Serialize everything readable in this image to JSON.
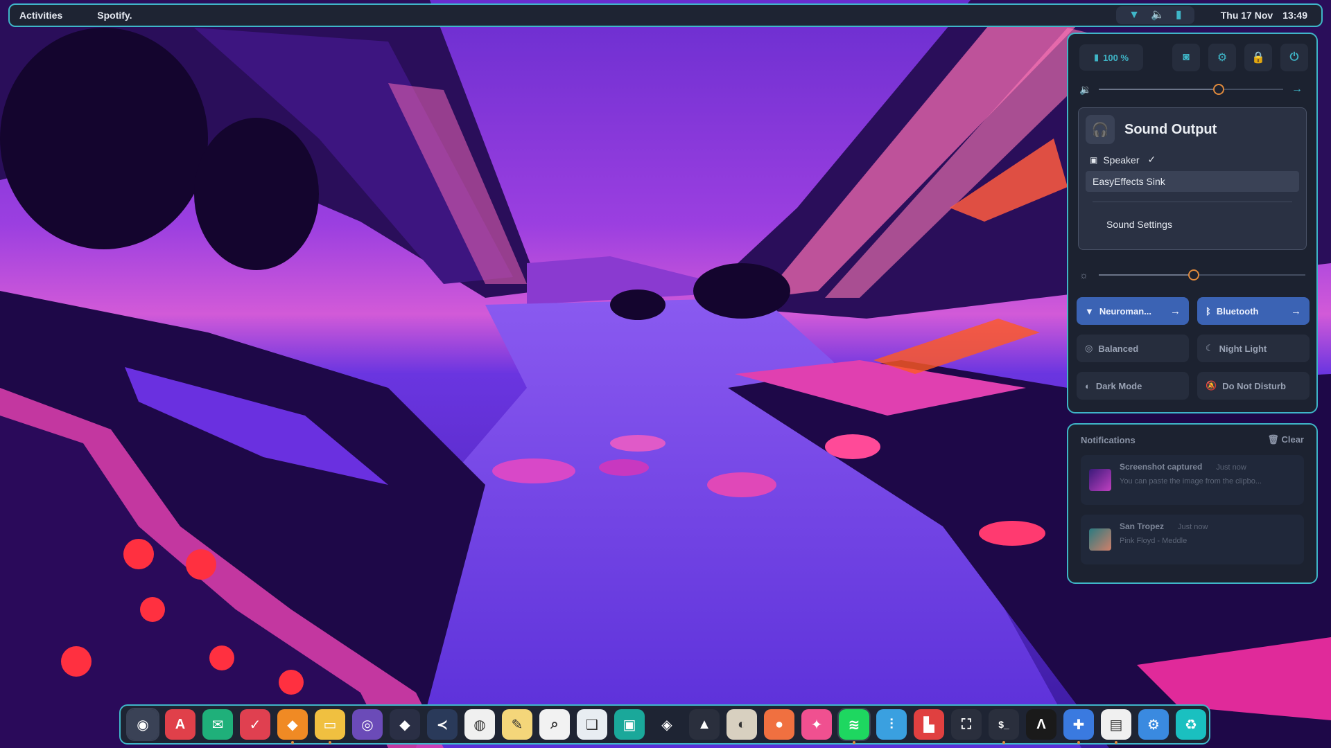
{
  "topbar": {
    "activities": "Activities",
    "app_name": "Spotify.",
    "tray_icons": [
      "wifi-icon",
      "volume-icon",
      "battery-icon"
    ],
    "date": "Thu 17 Nov",
    "time": "13:49"
  },
  "quick_settings": {
    "battery": "100 %",
    "icons": [
      "screenshot-icon",
      "settings-icon",
      "lock-icon",
      "power-icon"
    ],
    "volume_level": 0.65,
    "brightness_level": 0.46,
    "sound_output": {
      "title": "Sound Output",
      "devices": [
        {
          "label": "Speaker",
          "selected": true
        },
        {
          "label": "EasyEffects Sink",
          "selected": false
        }
      ],
      "settings_label": "Sound Settings"
    },
    "toggles": [
      {
        "label": "Neuroman...",
        "icon": "wifi-icon",
        "active": true,
        "has_arrow": true
      },
      {
        "label": "Bluetooth",
        "icon": "bluetooth-icon",
        "active": true,
        "has_arrow": true
      },
      {
        "label": "Balanced",
        "icon": "power-profile-icon",
        "active": false,
        "has_arrow": false
      },
      {
        "label": "Night Light",
        "icon": "moon-icon",
        "active": false,
        "has_arrow": false
      },
      {
        "label": "Dark Mode",
        "icon": "contrast-icon",
        "active": false,
        "has_arrow": false
      },
      {
        "label": "Do Not Disturb",
        "icon": "bell-off-icon",
        "active": false,
        "has_arrow": false
      }
    ]
  },
  "notifications": {
    "title": "Notifications",
    "clear_label": "Clear",
    "items": [
      {
        "title": "Screenshot captured",
        "time": "Just now",
        "message": "You can paste the image from the clipbo..."
      },
      {
        "title": "San Tropez",
        "time": "Just now",
        "message": "Pink Floyd - Meddle"
      }
    ]
  },
  "dock": {
    "apps": [
      {
        "name": "eye-app-icon",
        "color": "#3a4256",
        "glyph": "◉",
        "running": false,
        "active": true
      },
      {
        "name": "app-store-icon",
        "color": "#e0404a",
        "glyph": "A",
        "running": false
      },
      {
        "name": "mail-icon",
        "color": "#1fb07a",
        "glyph": "✉",
        "running": false
      },
      {
        "name": "tasks-icon",
        "color": "#e04050",
        "glyph": "✓",
        "running": false
      },
      {
        "name": "brave-browser-icon",
        "color": "#f08a24",
        "glyph": "◆",
        "running": true
      },
      {
        "name": "files-icon",
        "color": "#f0c040",
        "glyph": "▭",
        "running": true
      },
      {
        "name": "github-icon",
        "color": "#6b4bb8",
        "glyph": "◎",
        "running": false
      },
      {
        "name": "obsidian-icon",
        "color": "#2a2f45",
        "glyph": "◆",
        "running": false
      },
      {
        "name": "vscode-icon",
        "color": "#2a3a5a",
        "glyph": "≺",
        "running": false
      },
      {
        "name": "chromium-icon",
        "color": "#f0f0f0",
        "glyph": "◍",
        "running": false
      },
      {
        "name": "text-editor-icon",
        "color": "#f4d67a",
        "glyph": "✎",
        "running": false
      },
      {
        "name": "search-icon",
        "color": "#f2f2f2",
        "glyph": "⌕",
        "running": false
      },
      {
        "name": "book-reader-icon",
        "color": "#e8edf2",
        "glyph": "❑",
        "running": false
      },
      {
        "name": "screenshot-tool-icon",
        "color": "#1aa89a",
        "glyph": "▣",
        "running": false
      },
      {
        "name": "figma-icon",
        "color": "#1e2433",
        "glyph": "◈",
        "running": false
      },
      {
        "name": "inkscape-icon",
        "color": "#2a2f3d",
        "glyph": "▲",
        "running": false
      },
      {
        "name": "gimp-icon",
        "color": "#d8d0c0",
        "glyph": "◐",
        "running": false
      },
      {
        "name": "color-picker-icon",
        "color": "#f07040",
        "glyph": "●",
        "running": false
      },
      {
        "name": "media-player-icon",
        "color": "#f05090",
        "glyph": "✦",
        "running": false
      },
      {
        "name": "spotify-icon",
        "color": "#1ed760",
        "glyph": "≋",
        "running": true,
        "active": true
      },
      {
        "name": "equalizer-icon",
        "color": "#3aa0e0",
        "glyph": "⫶",
        "running": false
      },
      {
        "name": "audio-waveform-icon",
        "color": "#e04040",
        "glyph": "▙",
        "running": false
      },
      {
        "name": "screen-capture-icon",
        "color": "#2a2f3d",
        "glyph": "⛶",
        "running": false
      },
      {
        "name": "terminal-icon",
        "color": "#2a2f3d",
        "glyph": "$_",
        "running": true
      },
      {
        "name": "alacritty-icon",
        "color": "#1a1a1a",
        "glyph": "Λ",
        "running": false
      },
      {
        "name": "extensions-icon",
        "color": "#3a7ae0",
        "glyph": "✚",
        "running": true
      },
      {
        "name": "tweaks-icon",
        "color": "#f0f0f0",
        "glyph": "▤",
        "running": true
      },
      {
        "name": "settings-app-icon",
        "color": "#3a8ae0",
        "glyph": "⚙",
        "running": false
      },
      {
        "name": "trash-icon",
        "color": "#1ac0c0",
        "glyph": "♻",
        "running": false
      }
    ]
  }
}
